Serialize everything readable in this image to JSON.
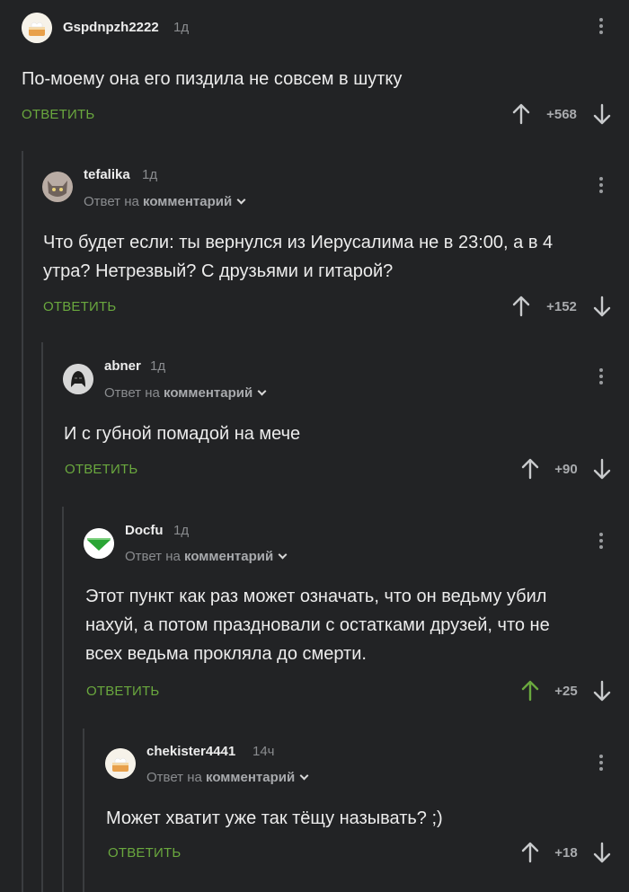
{
  "comments": [
    {
      "username": "Gspdnpzh2222",
      "time": "1д",
      "reply_prefix": "",
      "reply_target": "",
      "text": "По-моему она его пиздила не совсем в шутку",
      "reply_label": "ОТВЕТИТЬ",
      "score": "+568",
      "upvoted": false,
      "avatar": "cake-avatar"
    },
    {
      "username": "tefalika",
      "time": "1д",
      "reply_prefix": "Ответ на",
      "reply_target": "комментарий",
      "text": "Что будет если: ты вернулся из Иерусалима не в 23:00, а в 4 утра? Нетрезвый? С друзьями и гитарой?",
      "reply_label": "ОТВЕТИТЬ",
      "score": "+152",
      "upvoted": false,
      "avatar": "cat-avatar"
    },
    {
      "username": "abner",
      "time": "1д",
      "reply_prefix": "Ответ на",
      "reply_target": "комментарий",
      "text": "И с губной помадой на мече",
      "reply_label": "ОТВЕТИТЬ",
      "score": "+90",
      "upvoted": false,
      "avatar": "vader-avatar"
    },
    {
      "username": "Docfu",
      "time": "1д",
      "reply_prefix": "Ответ на",
      "reply_target": "комментарий",
      "text": "Этот пункт как раз может означать, что он ведьму убил нахуй, а потом праздновали с остатками друзей, что не всех ведьма прокляла до смерти.",
      "reply_label": "ОТВЕТИТЬ",
      "score": "+25",
      "upvoted": true,
      "avatar": "green-logo-avatar"
    },
    {
      "username": "chekister4441",
      "time": "14ч",
      "reply_prefix": "Ответ на",
      "reply_target": "комментарий",
      "text": "Может хватит уже так тёщу называть? ;)",
      "reply_label": "ОТВЕТИТЬ",
      "score": "+18",
      "upvoted": false,
      "avatar": "cake-avatar"
    }
  ],
  "colors": {
    "background": "#222325",
    "reply_green": "#6aa83e",
    "upvoted_green": "#6aa83e",
    "arrow_default": "#c8cacc"
  }
}
